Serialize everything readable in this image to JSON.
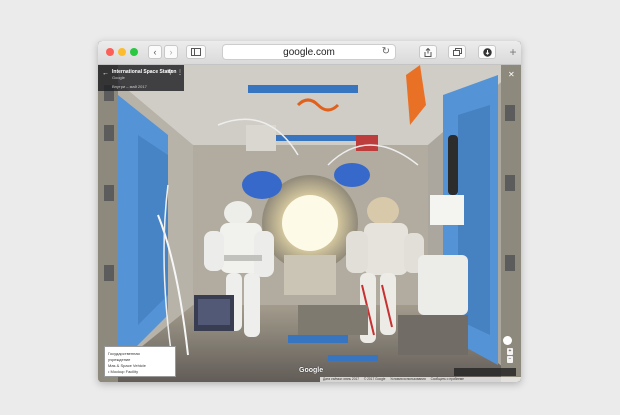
{
  "browser": {
    "url": "google.com",
    "back_icon": "chevron-left-icon",
    "forward_icon": "chevron-right-icon",
    "sidebar_icon": "sidebar-icon",
    "reload_icon": "reload-icon",
    "share_icon": "share-icon",
    "tabs_icon": "tabs-icon",
    "download_icon": "download-icon",
    "new_tab_icon": "plus-icon"
  },
  "infocard": {
    "title": "International Space Station",
    "subtitle": "Google",
    "date": "Внутри – май 2017"
  },
  "thumbnail": {
    "line1": "Государственная",
    "line2": "учреждение",
    "line3": "Mas & Space Vehicle",
    "line4": "• Mockup Facility"
  },
  "map": {
    "logo": "Google",
    "footer": [
      "Дата съёмки: июнь 2017",
      "© 2017 Google",
      "Условия использования",
      "Сообщить о проблеме"
    ]
  },
  "colors": {
    "wall_blue": "#4d8fd6",
    "window_dark": "#1a1d22",
    "tint": "#e8eef2"
  }
}
